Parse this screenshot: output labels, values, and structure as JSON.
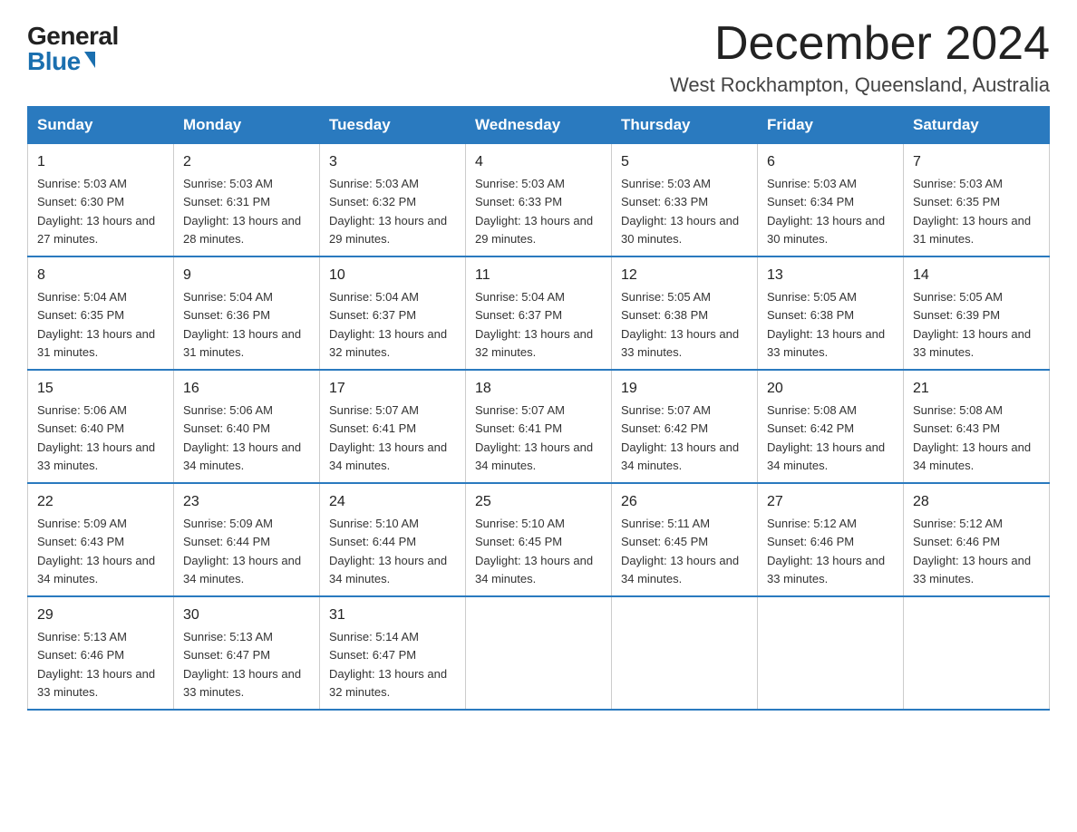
{
  "logo": {
    "general": "General",
    "blue": "Blue"
  },
  "title": "December 2024",
  "location": "West Rockhampton, Queensland, Australia",
  "weekdays": [
    "Sunday",
    "Monday",
    "Tuesday",
    "Wednesday",
    "Thursday",
    "Friday",
    "Saturday"
  ],
  "weeks": [
    [
      {
        "day": "1",
        "sunrise": "5:03 AM",
        "sunset": "6:30 PM",
        "daylight": "13 hours and 27 minutes."
      },
      {
        "day": "2",
        "sunrise": "5:03 AM",
        "sunset": "6:31 PM",
        "daylight": "13 hours and 28 minutes."
      },
      {
        "day": "3",
        "sunrise": "5:03 AM",
        "sunset": "6:32 PM",
        "daylight": "13 hours and 29 minutes."
      },
      {
        "day": "4",
        "sunrise": "5:03 AM",
        "sunset": "6:33 PM",
        "daylight": "13 hours and 29 minutes."
      },
      {
        "day": "5",
        "sunrise": "5:03 AM",
        "sunset": "6:33 PM",
        "daylight": "13 hours and 30 minutes."
      },
      {
        "day": "6",
        "sunrise": "5:03 AM",
        "sunset": "6:34 PM",
        "daylight": "13 hours and 30 minutes."
      },
      {
        "day": "7",
        "sunrise": "5:03 AM",
        "sunset": "6:35 PM",
        "daylight": "13 hours and 31 minutes."
      }
    ],
    [
      {
        "day": "8",
        "sunrise": "5:04 AM",
        "sunset": "6:35 PM",
        "daylight": "13 hours and 31 minutes."
      },
      {
        "day": "9",
        "sunrise": "5:04 AM",
        "sunset": "6:36 PM",
        "daylight": "13 hours and 31 minutes."
      },
      {
        "day": "10",
        "sunrise": "5:04 AM",
        "sunset": "6:37 PM",
        "daylight": "13 hours and 32 minutes."
      },
      {
        "day": "11",
        "sunrise": "5:04 AM",
        "sunset": "6:37 PM",
        "daylight": "13 hours and 32 minutes."
      },
      {
        "day": "12",
        "sunrise": "5:05 AM",
        "sunset": "6:38 PM",
        "daylight": "13 hours and 33 minutes."
      },
      {
        "day": "13",
        "sunrise": "5:05 AM",
        "sunset": "6:38 PM",
        "daylight": "13 hours and 33 minutes."
      },
      {
        "day": "14",
        "sunrise": "5:05 AM",
        "sunset": "6:39 PM",
        "daylight": "13 hours and 33 minutes."
      }
    ],
    [
      {
        "day": "15",
        "sunrise": "5:06 AM",
        "sunset": "6:40 PM",
        "daylight": "13 hours and 33 minutes."
      },
      {
        "day": "16",
        "sunrise": "5:06 AM",
        "sunset": "6:40 PM",
        "daylight": "13 hours and 34 minutes."
      },
      {
        "day": "17",
        "sunrise": "5:07 AM",
        "sunset": "6:41 PM",
        "daylight": "13 hours and 34 minutes."
      },
      {
        "day": "18",
        "sunrise": "5:07 AM",
        "sunset": "6:41 PM",
        "daylight": "13 hours and 34 minutes."
      },
      {
        "day": "19",
        "sunrise": "5:07 AM",
        "sunset": "6:42 PM",
        "daylight": "13 hours and 34 minutes."
      },
      {
        "day": "20",
        "sunrise": "5:08 AM",
        "sunset": "6:42 PM",
        "daylight": "13 hours and 34 minutes."
      },
      {
        "day": "21",
        "sunrise": "5:08 AM",
        "sunset": "6:43 PM",
        "daylight": "13 hours and 34 minutes."
      }
    ],
    [
      {
        "day": "22",
        "sunrise": "5:09 AM",
        "sunset": "6:43 PM",
        "daylight": "13 hours and 34 minutes."
      },
      {
        "day": "23",
        "sunrise": "5:09 AM",
        "sunset": "6:44 PM",
        "daylight": "13 hours and 34 minutes."
      },
      {
        "day": "24",
        "sunrise": "5:10 AM",
        "sunset": "6:44 PM",
        "daylight": "13 hours and 34 minutes."
      },
      {
        "day": "25",
        "sunrise": "5:10 AM",
        "sunset": "6:45 PM",
        "daylight": "13 hours and 34 minutes."
      },
      {
        "day": "26",
        "sunrise": "5:11 AM",
        "sunset": "6:45 PM",
        "daylight": "13 hours and 34 minutes."
      },
      {
        "day": "27",
        "sunrise": "5:12 AM",
        "sunset": "6:46 PM",
        "daylight": "13 hours and 33 minutes."
      },
      {
        "day": "28",
        "sunrise": "5:12 AM",
        "sunset": "6:46 PM",
        "daylight": "13 hours and 33 minutes."
      }
    ],
    [
      {
        "day": "29",
        "sunrise": "5:13 AM",
        "sunset": "6:46 PM",
        "daylight": "13 hours and 33 minutes."
      },
      {
        "day": "30",
        "sunrise": "5:13 AM",
        "sunset": "6:47 PM",
        "daylight": "13 hours and 33 minutes."
      },
      {
        "day": "31",
        "sunrise": "5:14 AM",
        "sunset": "6:47 PM",
        "daylight": "13 hours and 32 minutes."
      },
      null,
      null,
      null,
      null
    ]
  ]
}
